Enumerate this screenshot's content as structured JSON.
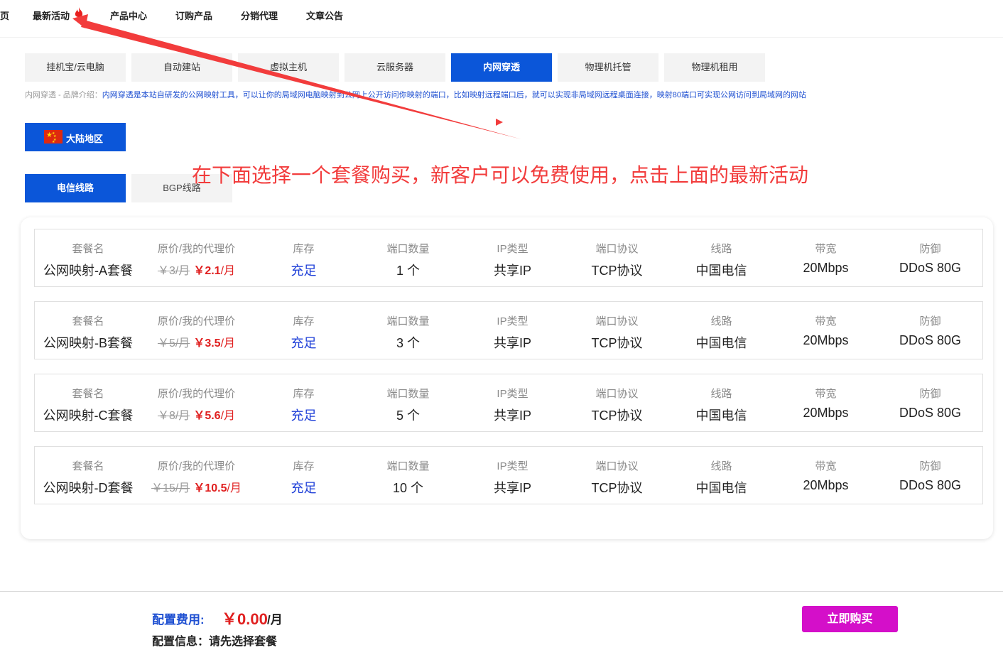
{
  "nav": {
    "items": [
      "页",
      "最新活动",
      "产品中心",
      "订购产品",
      "分销代理",
      "文章公告"
    ]
  },
  "product_tabs": [
    {
      "label": "挂机宝/云电脑",
      "active": false
    },
    {
      "label": "自动建站",
      "active": false
    },
    {
      "label": "虚拟主机",
      "active": false
    },
    {
      "label": "云服务器",
      "active": false
    },
    {
      "label": "内网穿透",
      "active": true
    },
    {
      "label": "物理机托管",
      "active": false
    },
    {
      "label": "物理机租用",
      "active": false
    }
  ],
  "brand": {
    "prefix": "内网穿透 - 品牌介绍：",
    "description": "内网穿透是本站自研发的公网映射工具，可以让你的局域网电脑映射到公网上公开访问你映射的端口，比如映射远程端口后，就可以实现非局域网远程桌面连接，映射80端口可实现公网访问到局域网的网站"
  },
  "region": {
    "label": "大陆地区",
    "flag_icon": "china-flag-icon"
  },
  "line_tabs": [
    {
      "label": "电信线路",
      "active": true
    },
    {
      "label": "BGP线路",
      "active": false
    }
  ],
  "annotation": "在下面选择一个套餐购买，新客户可以免费使用，点击上面的最新活动",
  "column_labels": {
    "name": "套餐名",
    "price": "原价/我的代理价",
    "stock": "库存",
    "ports": "端口数量",
    "ip_type": "IP类型",
    "protocol": "端口协议",
    "line": "线路",
    "bandwidth": "带宽",
    "defense": "防御"
  },
  "packages": [
    {
      "name": "公网映射-A套餐",
      "orig_price": "￥3/月",
      "agent_price": "￥2.1",
      "price_unit": "/月",
      "stock": "充足",
      "ports": "1 个",
      "ip_type": "共享IP",
      "protocol": "TCP协议",
      "line": "中国电信",
      "bandwidth": "20Mbps",
      "defense": "DDoS 80G"
    },
    {
      "name": "公网映射-B套餐",
      "orig_price": "￥5/月",
      "agent_price": "￥3.5",
      "price_unit": "/月",
      "stock": "充足",
      "ports": "3 个",
      "ip_type": "共享IP",
      "protocol": "TCP协议",
      "line": "中国电信",
      "bandwidth": "20Mbps",
      "defense": "DDoS 80G"
    },
    {
      "name": "公网映射-C套餐",
      "orig_price": "￥8/月",
      "agent_price": "￥5.6",
      "price_unit": "/月",
      "stock": "充足",
      "ports": "5 个",
      "ip_type": "共享IP",
      "protocol": "TCP协议",
      "line": "中国电信",
      "bandwidth": "20Mbps",
      "defense": "DDoS 80G"
    },
    {
      "name": "公网映射-D套餐",
      "orig_price": "￥15/月",
      "agent_price": "￥10.5",
      "price_unit": "/月",
      "stock": "充足",
      "ports": "10 个",
      "ip_type": "共享IP",
      "protocol": "TCP协议",
      "line": "中国电信",
      "bandwidth": "20Mbps",
      "defense": "DDoS 80G"
    }
  ],
  "footer": {
    "fee_label": "配置费用:",
    "fee_value": "￥0.00",
    "fee_unit": "/月",
    "info": "配置信息：请先选择套餐",
    "buy_label": "立即购买"
  },
  "colors": {
    "primary": "#0b56d9",
    "price_red": "#e02020",
    "annotation_red": "#f23c3c",
    "buy_button": "#d40fc9"
  }
}
